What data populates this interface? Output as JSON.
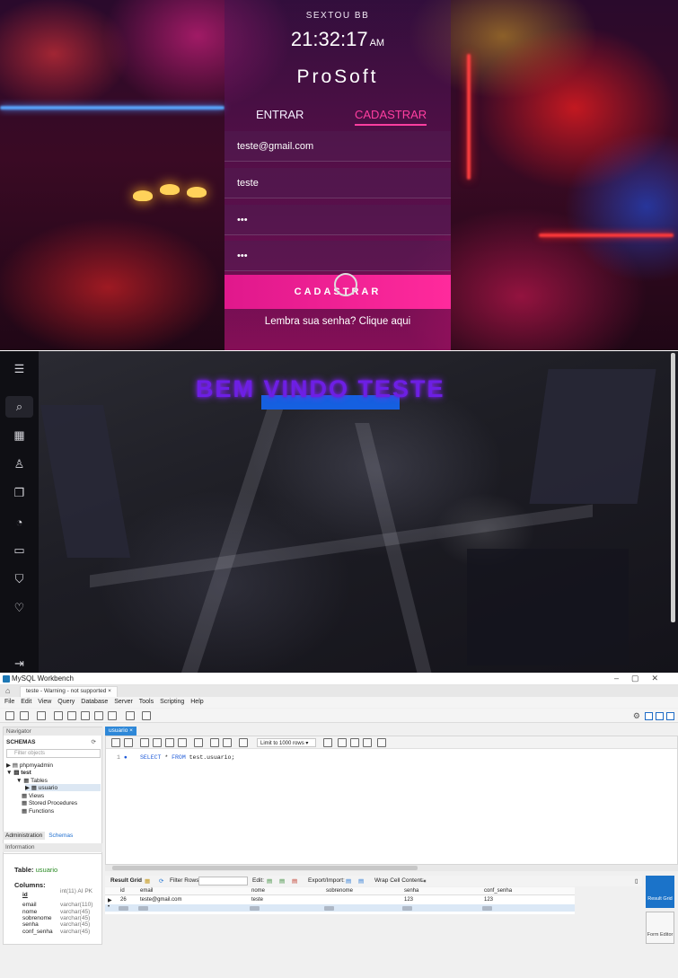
{
  "login": {
    "day": "SEXTOU BB",
    "time": "21:32:17",
    "ampm": "AM",
    "brand": "ProSoft",
    "tab_login": "ENTRAR",
    "tab_register": "CADASTRAR",
    "fields": [
      "teste@gmail.com",
      "teste",
      "•••",
      "•••"
    ],
    "submit": "CADASTRAR",
    "forgot": "Lembra sua senha? Clique aqui"
  },
  "dashboard": {
    "welcome": "BEM VINDO TESTE",
    "sidebar_icons": [
      "menu-icon",
      "search-icon",
      "grid-icon",
      "user-icon",
      "cards-icon",
      "chart-pie-icon",
      "folder-icon",
      "cart-icon",
      "heart-icon",
      "logout-icon"
    ]
  },
  "workbench": {
    "window_title": "MySQL Workbench",
    "connection_tab": "teste - Warning - not supported",
    "menu": [
      "File",
      "Edit",
      "View",
      "Query",
      "Database",
      "Server",
      "Tools",
      "Scripting",
      "Help"
    ],
    "navigator": "Navigator",
    "schemas_label": "SCHEMAS",
    "filter_placeholder": "Filter objects",
    "tree": {
      "phpmyadmin": "phpmyadmin",
      "test": "test",
      "tables": "Tables",
      "usuario": "usuario",
      "views": "Views",
      "procs": "Stored Procedures",
      "funcs": "Functions"
    },
    "nav_tabs": [
      "Administration",
      "Schemas"
    ],
    "information": "Information",
    "table_label": "Table:",
    "table_name": "usuario",
    "columns_label": "Columns:",
    "columns": [
      {
        "name": "id",
        "type": "int(11) AI PK"
      },
      {
        "name": "email",
        "type": "varchar(110)"
      },
      {
        "name": "nome",
        "type": "varchar(45)"
      },
      {
        "name": "sobrenome",
        "type": "varchar(45)"
      },
      {
        "name": "senha",
        "type": "varchar(45)"
      },
      {
        "name": "conf_senha",
        "type": "varchar(45)"
      }
    ],
    "query_tab": "usuario",
    "limit": "Limit to 1000 rows",
    "line_no": "1",
    "sql_kw1": "SELECT",
    "sql_star": "*",
    "sql_kw2": "FROM",
    "sql_rest": "test.usuario;",
    "result_grid": "Result Grid",
    "filter_rows": "Filter Rows:",
    "edit": "Edit:",
    "export": "Export/Import:",
    "wrap": "Wrap Cell Content:",
    "grid_headers": [
      "id",
      "email",
      "nome",
      "sobrenome",
      "senha",
      "conf_senha"
    ],
    "row1": [
      "26",
      "teste@gmail.com",
      "teste",
      "",
      "123",
      "123"
    ],
    "null_text": "NULL",
    "side_result": "Result Grid",
    "side_form": "Form Editor"
  }
}
